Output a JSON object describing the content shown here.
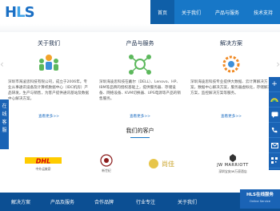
{
  "logo": {
    "part1": "H",
    "part2": "L",
    "part3": "S"
  },
  "nav": {
    "items": [
      "首页",
      "关于我们",
      "产品与服务",
      "技术支持"
    ],
    "active_index": 0
  },
  "columns": [
    {
      "title": "关于我们",
      "text": "深圳市海凌思科技有限公司，成立于2006年。专业从事通讯设备及计算机数据中心（IDC机房）产品研发，生产与销售，为客户提供通讯基站及数据中心解决方案。",
      "more": "查看更多>>"
    },
    {
      "title": "产品与服务",
      "text": "深圳海凌思科技在戴尔（DELL）、Lenovo、HP、IBM等品牌的授权基础上，提供服务器、存储设备、网络设备、KVM切换器、UPS电源等产品的销售服务。",
      "more": "查看更多>>"
    },
    {
      "title": "解决方案",
      "text": "深圳海凌思科技专业提供大数据、云计算解决方案，数据中心解决方案，服务器虚拟化，存储解决方案，监控解决方案等服务。",
      "more": "查看更多>>"
    }
  ],
  "clients_title": "我们的客户",
  "clients": [
    {
      "name": "DHL",
      "sub": "中外运敦豪"
    },
    {
      "name": "新世纪",
      "sub": ""
    },
    {
      "name": "尚佳",
      "sub": ""
    },
    {
      "name": "JW MARRIOTT",
      "sub": "深圳宝安JW万豪酒店"
    }
  ],
  "left_panel": [
    "在",
    "线",
    "客",
    "服"
  ],
  "footer": {
    "links": [
      "解决方案",
      "产品及服务",
      "合作品牌",
      "行业专注",
      "关于我们"
    ]
  },
  "chat_badge": {
    "title": "HLS在线服务",
    "sub": "Online Service"
  },
  "colors": {
    "primary": "#1777c7",
    "dark": "#0c4f93",
    "side": "#1a63b5"
  }
}
